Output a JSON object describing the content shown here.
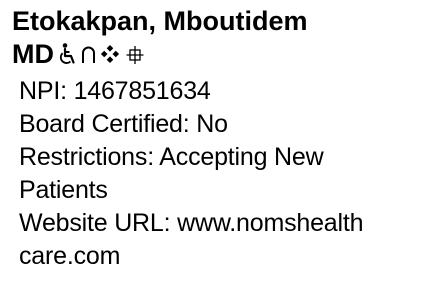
{
  "provider": {
    "name": "Etokakpan, Mboutidem",
    "degree": "MD",
    "icons": [
      "wheelchair-accessible-icon",
      "intersection-icon",
      "diamond-cluster-icon",
      "crosshair-square-icon"
    ],
    "npi_line": "NPI: 1467851634",
    "board_line": "Board Certified: No",
    "restrictions_line1": "Restrictions: Accepting New",
    "restrictions_line2": "Patients",
    "website_line1": "Website URL: www.nomshealth",
    "website_line2": "care.com"
  }
}
